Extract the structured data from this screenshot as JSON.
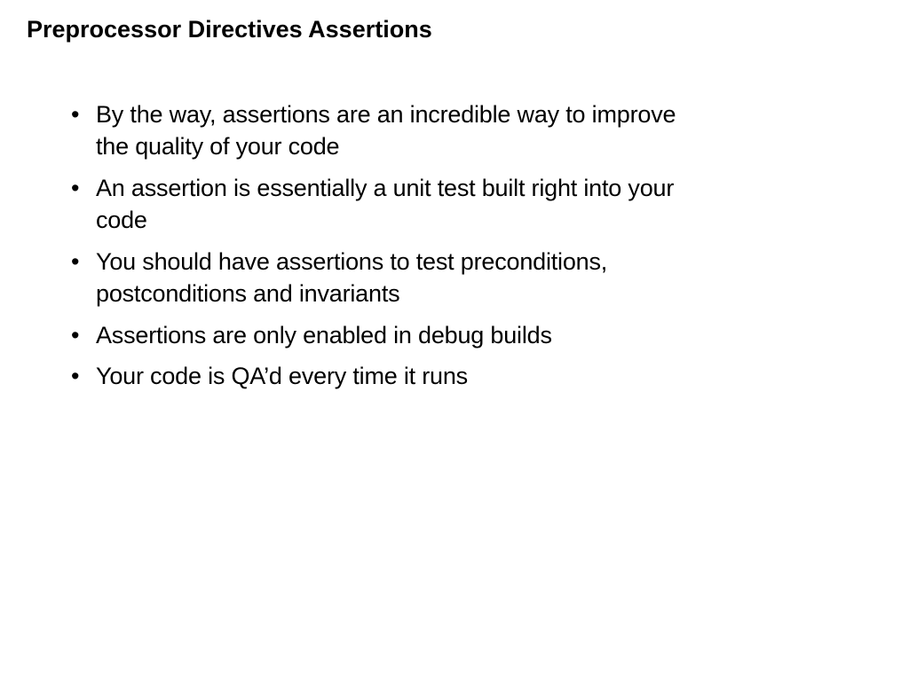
{
  "slide": {
    "title": "Preprocessor Directives Assertions",
    "bullets": [
      "By the way, assertions are an incredible way to improve the quality of your code",
      "An assertion is essentially a unit test built right into your code",
      "You should have assertions to test preconditions, postconditions and invariants",
      "Assertions are only enabled in debug builds",
      "Your code is QA’d every time it runs"
    ]
  }
}
